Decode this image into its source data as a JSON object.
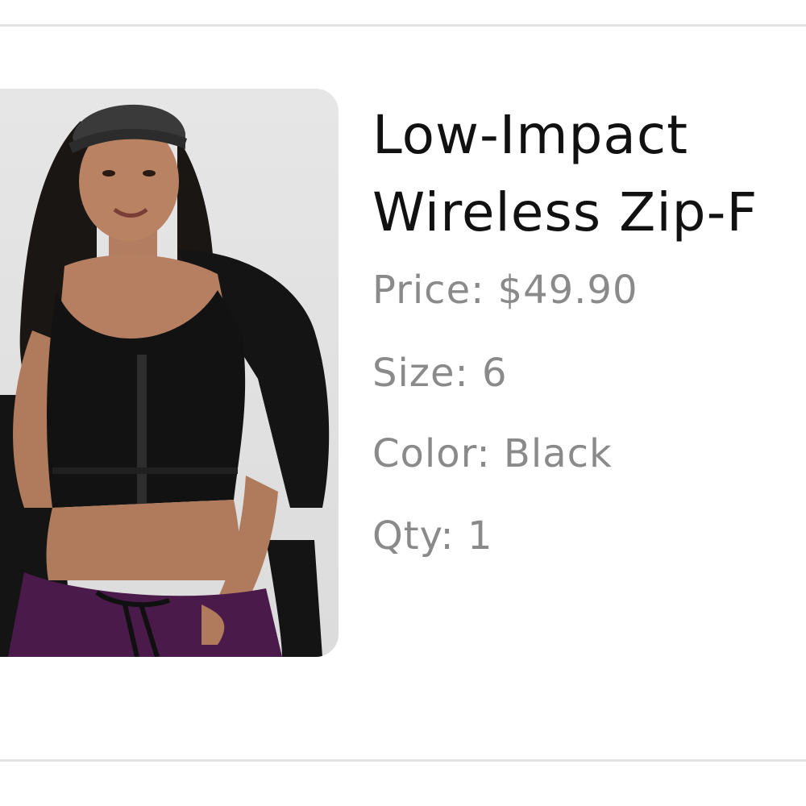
{
  "product": {
    "title_line1": "Low-Impact",
    "title_line2": "Wireless Zip-F",
    "price_label": "Price:",
    "price_value": "$49.90",
    "size_label": "Size:",
    "size_value": "6",
    "color_label": "Color:",
    "color_value": "Black",
    "qty_label": "Qty:",
    "qty_value": "1"
  },
  "colors": {
    "title": "#111111",
    "meta": "#8a8a8a",
    "divider": "#e3e3e3",
    "image_bg": "#e0e0e0"
  }
}
